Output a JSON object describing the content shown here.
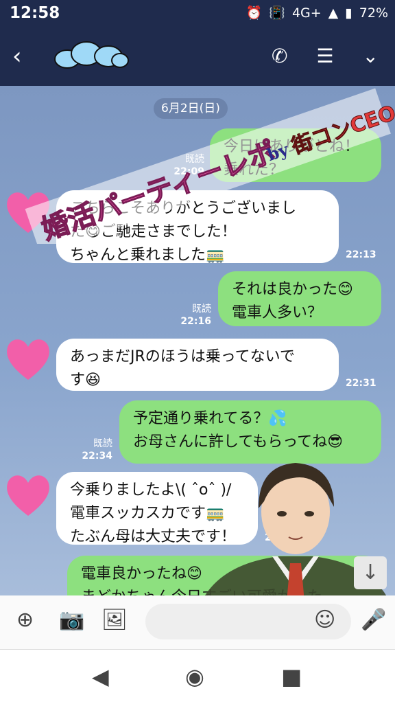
{
  "status": {
    "time": "12:58",
    "network": "4G+",
    "battery": "72%"
  },
  "chat": {
    "date": "6月2日(日)",
    "messages": [
      {
        "side": "me",
        "lines": [
          "今日はありがとね！",
          "乗れた？"
        ],
        "read": "既読",
        "time": "22:09"
      },
      {
        "side": "them",
        "lines": [
          "こちらこそありがとうございまし",
          "た😋ご馳走さまでした！",
          "ちゃんと乗れました🚃"
        ],
        "time": "22:13"
      },
      {
        "side": "me",
        "lines": [
          "それは良かった😊",
          "電車人多い？"
        ],
        "read": "既読",
        "time": "22:16"
      },
      {
        "side": "them",
        "lines": [
          "あっまだJRのほうは乗ってないで",
          "す😆"
        ],
        "time": "22:31"
      },
      {
        "side": "me",
        "lines": [
          "予定通り乗れてる？💦",
          "お母さんに許してもらってね😎"
        ],
        "read": "既読",
        "time": "22:34"
      },
      {
        "side": "them",
        "lines": [
          "今乗りましたよ\\( ˆoˆ )/",
          "電車スッカスカです🚃",
          "たぶん母は大丈夫です！"
        ],
        "time": "22:36"
      },
      {
        "side": "me",
        "lines": [
          "電車良かったね😊",
          "まどかちゃん今日すごい可愛かった"
        ]
      }
    ]
  },
  "watermark": {
    "title": "婚活パーティーレポ",
    "by": "by",
    "brand": "街コンCEO"
  },
  "colors": {
    "header": "#1f2b4d",
    "me_bubble": "#8de07f",
    "them_bubble": "#ffffff",
    "heart": "#f25fa9"
  }
}
